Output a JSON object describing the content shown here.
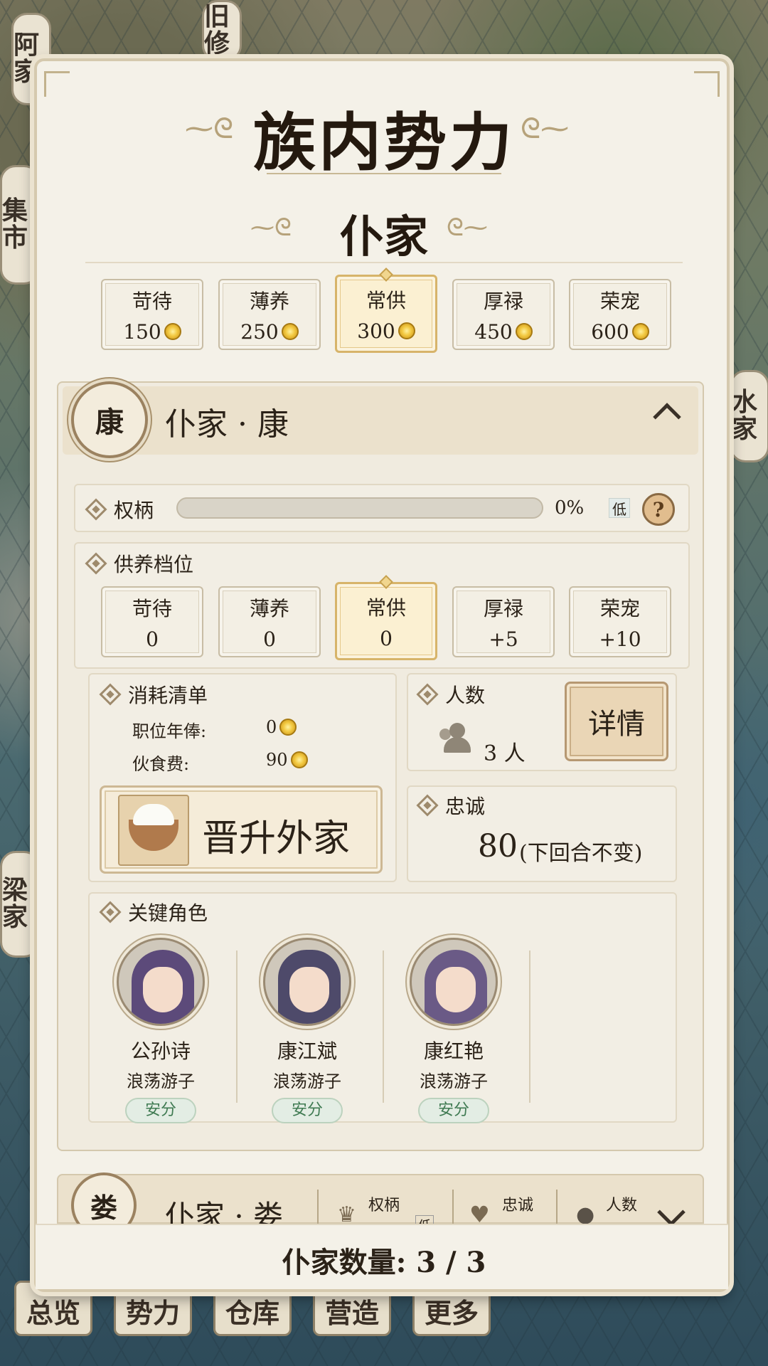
{
  "map_labels": {
    "top_sign": "旧修",
    "left_sign_top": "阿家",
    "left_sign_mid": "集市",
    "right_sign": "水家",
    "left_sign_bottom": "梁家"
  },
  "bottom_nav": [
    "总览",
    "势力",
    "仓库",
    "营造",
    "更多"
  ],
  "header": {
    "title": "族内势力",
    "subtitle": "仆家"
  },
  "tiers": [
    {
      "label": "苛待",
      "cost": "150"
    },
    {
      "label": "薄养",
      "cost": "250"
    },
    {
      "label": "常供",
      "cost": "300",
      "selected": true
    },
    {
      "label": "厚禄",
      "cost": "450"
    },
    {
      "label": "荣宠",
      "cost": "600"
    }
  ],
  "family": {
    "seal": "康",
    "name": "仆家 · 康",
    "power": {
      "label": "权柄",
      "value": 0,
      "percent": "0%",
      "level": "低",
      "help": "?"
    },
    "support": {
      "label": "供养档位",
      "tiers": [
        {
          "label": "苛待",
          "value": "0"
        },
        {
          "label": "薄养",
          "value": "0"
        },
        {
          "label": "常供",
          "value": "0",
          "selected": true
        },
        {
          "label": "厚禄",
          "value": "+5"
        },
        {
          "label": "荣宠",
          "value": "+10"
        }
      ]
    },
    "consumption": {
      "label": "消耗清单",
      "salary_label": "职位年俸:",
      "salary_value": "0",
      "food_label": "伙食费:",
      "food_value": "90"
    },
    "promote_label": "晋升外家",
    "headcount": {
      "label": "人数",
      "value": "3 人"
    },
    "detail_button": "详情",
    "loyalty": {
      "label": "忠诚",
      "value": "80",
      "note": "(下回合不变)"
    },
    "key_roles": {
      "label": "关键角色",
      "characters": [
        {
          "name": "公孙诗",
          "role": "浪荡游子",
          "status": "安分"
        },
        {
          "name": "康江斌",
          "role": "浪荡游子",
          "status": "安分"
        },
        {
          "name": "康红艳",
          "role": "浪荡游子",
          "status": "安分"
        }
      ]
    }
  },
  "family2": {
    "seal": "娄",
    "name": "仆家 · 娄",
    "power_label": "权柄",
    "level": "低",
    "loyalty_label": "忠诚",
    "headcount_label": "人数"
  },
  "footer": {
    "count_label": "仆家数量: 3 / 3"
  },
  "colors": {
    "accent": "#d7b46a",
    "panel": "#f4f1e8",
    "status_green": "#3f7a52"
  }
}
